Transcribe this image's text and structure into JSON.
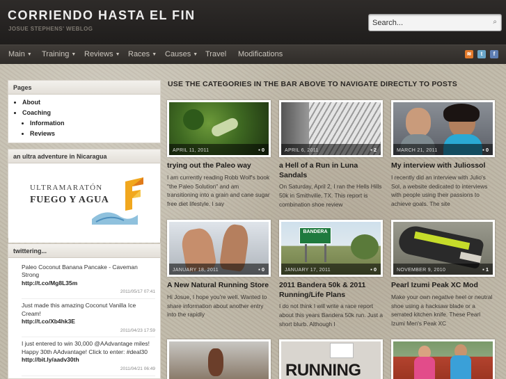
{
  "header": {
    "title": "CORRIENDO HASTA EL FIN",
    "subtitle": "JOSUE STEPHENS' WEBLOG",
    "search_placeholder": "Search..."
  },
  "nav": {
    "items": [
      {
        "label": "Main",
        "dropdown": true
      },
      {
        "label": "Training",
        "dropdown": true
      },
      {
        "label": "Reviews",
        "dropdown": true
      },
      {
        "label": "Races",
        "dropdown": true
      },
      {
        "label": "Causes",
        "dropdown": true
      },
      {
        "label": "Travel",
        "dropdown": false
      },
      {
        "label": "Modifications",
        "dropdown": false
      }
    ],
    "social": [
      "rss-icon",
      "twitter-icon",
      "facebook-icon"
    ]
  },
  "sidebar": {
    "pages_title": "Pages",
    "pages": [
      "About",
      "Coaching"
    ],
    "subpages": [
      "Information",
      "Reviews"
    ],
    "ad_title": "an ultra adventure in Nicaragua",
    "ad_line1": "ULTRAMARATÓN",
    "ad_line2": "FUEGO Y AGUA",
    "twitter_title": "twittering...",
    "tweets": [
      {
        "text": "Paleo Coconut Banana Pancake - Caveman Strong",
        "link": "http://t.co/Mg8L35m",
        "date": "2011/05/17 07:41"
      },
      {
        "text": "Just made this amazing Coconut Vanilla Ice Cream!",
        "link": "http://t.co/Xb4hk3E",
        "date": "2011/04/23 17:59"
      },
      {
        "text": "I just entered to win 30,000 @AAdvantage miles! Happy 30th AAdvantage! Click to enter: #deal30",
        "link": "http://bit.ly/aadv30th",
        "date": "2011/04/21 06:49"
      }
    ]
  },
  "main": {
    "heading": "USE THE CATEGORIES IN THE BAR ABOVE TO NAVIGATE DIRECTLY TO POSTS",
    "posts": [
      {
        "date": "APRIL 11, 2011",
        "comments": "0",
        "title": "trying out the Paleo way",
        "excerpt": "I am currently reading Robb Wolf's book \"the Paleo Solution\" and am transitioning into a grain and cane sugar free diet lifestyle. I say"
      },
      {
        "date": "APRIL 6, 2011",
        "comments": "2",
        "title": "a Hell of a Run in Luna Sandals",
        "excerpt": "On Saturday, April 2, I ran the Hells Hills 50k in Smithville, TX. This report is combination shoe review"
      },
      {
        "date": "MARCH 21, 2011",
        "comments": "0",
        "title": "My interview with Juliossol",
        "excerpt": "I recently did an interview with Julio's Sol, a website dedicated to interviews with people using their passions to achieve goals. The site"
      },
      {
        "date": "JANUARY 18, 2011",
        "comments": "0",
        "title": "A New Natural Running Store",
        "excerpt": "Hi Josue, I hope you're well. Wanted to share information about another entry into the rapidly"
      },
      {
        "date": "JANUARY 17, 2011",
        "comments": "0",
        "title": "2011 Bandera 50k & 2011 Running/Life Plans",
        "excerpt": "I do not think I will write a race report about this years Bandera 50k run. Just a short blurb. Although I"
      },
      {
        "date": "NOVEMBER 9, 2010",
        "comments": "1",
        "title": "Pearl Izumi Peak XC Mod",
        "excerpt": "Make your own negative heel or neutral shoe using a hacksaw blade or a serrated kitchen knife. These Pearl Izumi Men's Peak XC"
      }
    ],
    "sign_text": "BANDERA",
    "magazine_text": "RUNNING"
  }
}
